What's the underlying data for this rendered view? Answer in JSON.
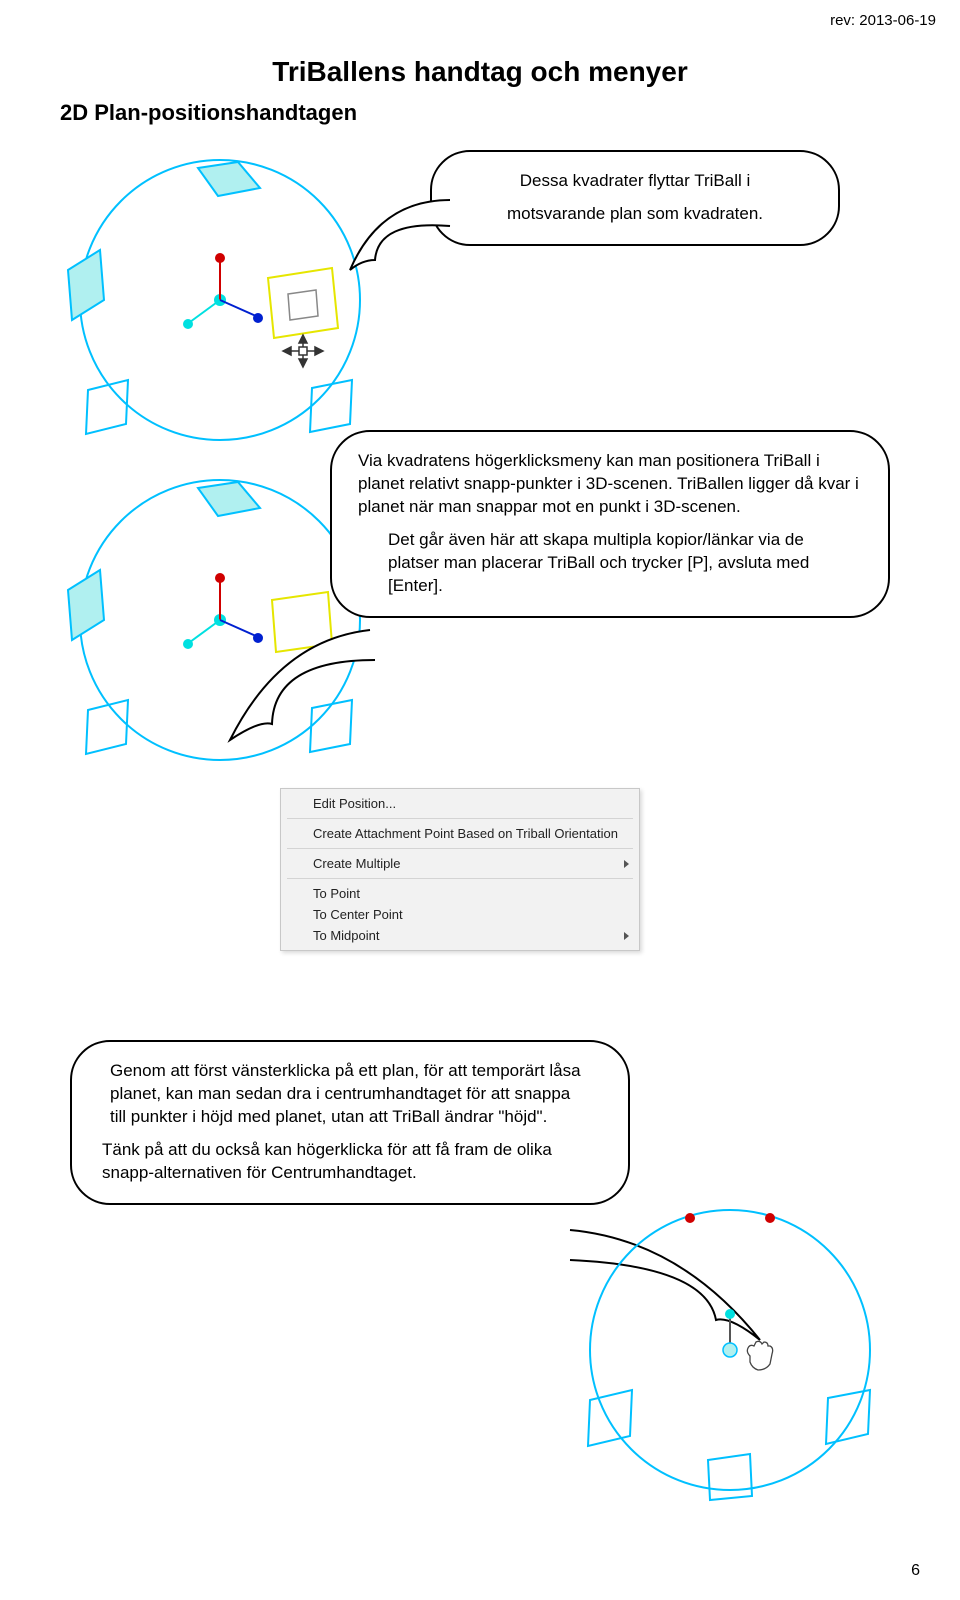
{
  "header": {
    "rev": "rev: 2013-06-19"
  },
  "title": "TriBallens handtag och menyer",
  "section": "2D Plan-positionshandtagen",
  "callout1": {
    "line1": "Dessa kvadrater flyttar TriBall i",
    "line2": "motsvarande plan som kvadraten."
  },
  "callout2": {
    "p1": "Via kvadratens högerklicksmeny kan man positionera TriBall i planet relativt snapp-punkter i 3D-scenen. TriBallen ligger då kvar i planet när man snappar mot en punkt i 3D-scenen.",
    "p2": "Det går även här att skapa multipla kopior/länkar via de platser man placerar TriBall och trycker [P], avsluta med [Enter]."
  },
  "menu": {
    "items": [
      {
        "label": "Edit Position...",
        "sub": false
      },
      {
        "label": "Create Attachment Point Based on Triball Orientation",
        "sub": false
      },
      {
        "label": "Create Multiple",
        "sub": true
      },
      {
        "label": "To Point",
        "sub": false
      },
      {
        "label": "To Center Point",
        "sub": false
      },
      {
        "label": "To Midpoint",
        "sub": true
      }
    ]
  },
  "callout3": {
    "p1": "Genom att först vänsterklicka på ett plan, för att temporärt låsa planet, kan man sedan dra i centrumhandtaget för att snappa till punkter i höjd med planet, utan att TriBall ändrar \"höjd\".",
    "p2": "Tänk på att du också kan högerklicka för att få fram de olika snapp-alternativen för Centrumhandtaget."
  },
  "page": "6"
}
